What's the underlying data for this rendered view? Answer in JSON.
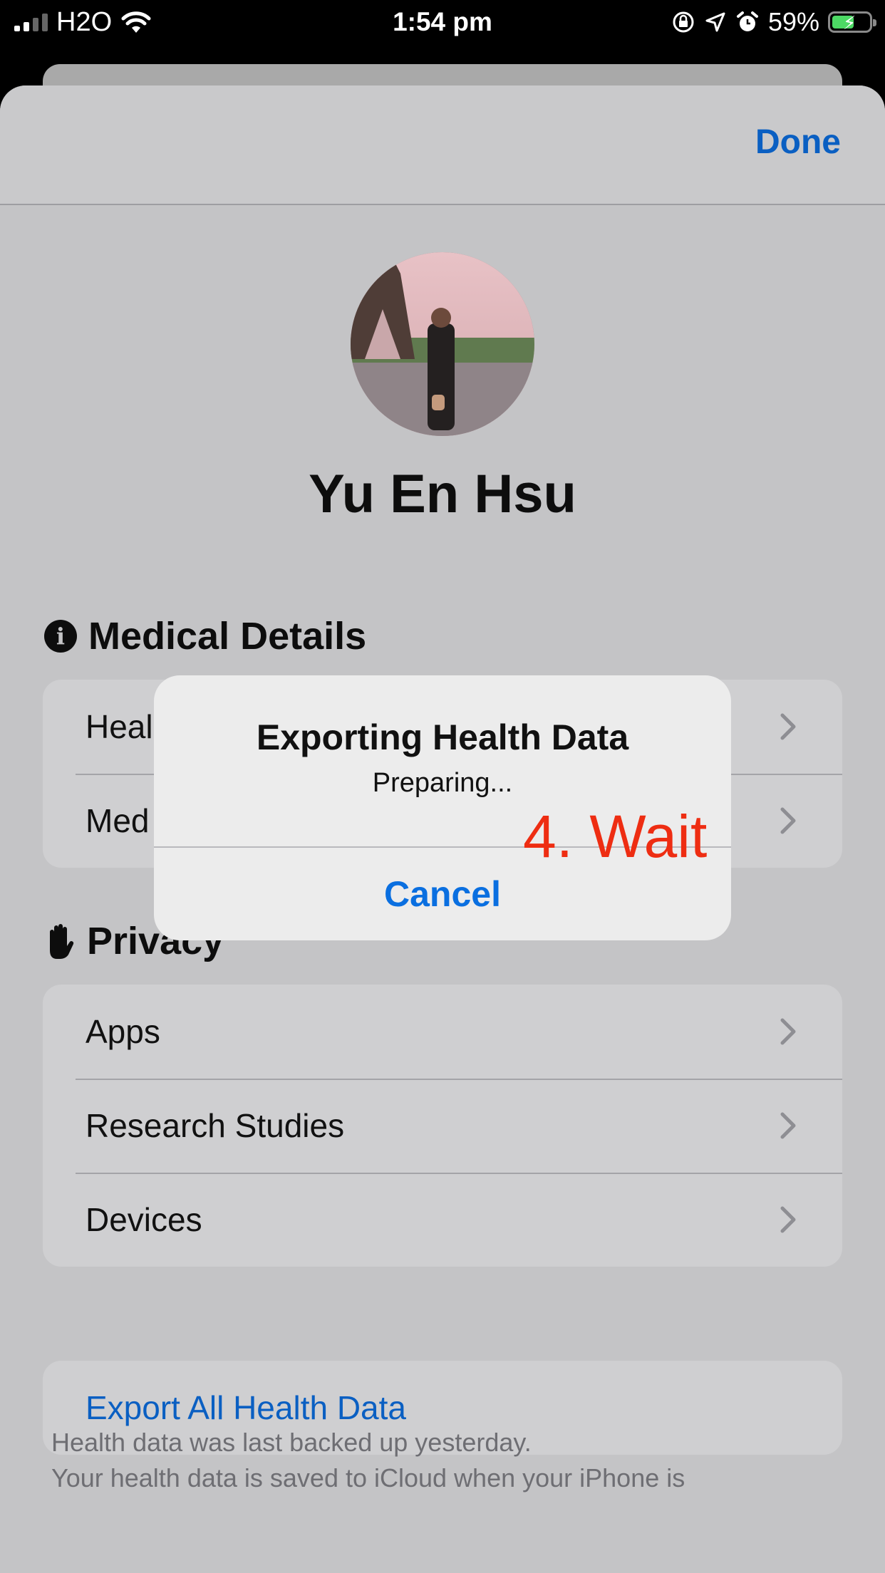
{
  "status_bar": {
    "carrier": "H2O",
    "time": "1:54 pm",
    "battery_percent": "59%",
    "battery_level": 0.59
  },
  "nav": {
    "done_label": "Done"
  },
  "profile": {
    "name": "Yu En Hsu"
  },
  "medical_details": {
    "title": "Medical Details",
    "rows": [
      {
        "label": "Heal"
      },
      {
        "label": "Med"
      }
    ]
  },
  "privacy": {
    "title": "Privacy",
    "rows": [
      {
        "label": "Apps"
      },
      {
        "label": "Research Studies"
      },
      {
        "label": "Devices"
      }
    ]
  },
  "export": {
    "label": "Export All Health Data"
  },
  "footer": {
    "line1": "Health data was last backed up yesterday.",
    "line2": "Your health data is saved to iCloud when your iPhone is"
  },
  "alert": {
    "title": "Exporting Health Data",
    "message": "Preparing...",
    "cancel_label": "Cancel"
  },
  "annotation": {
    "text": "4. Wait"
  },
  "colors": {
    "accent": "#0a5fc2",
    "annotation": "#ee2d12",
    "battery": "#4cd964"
  }
}
